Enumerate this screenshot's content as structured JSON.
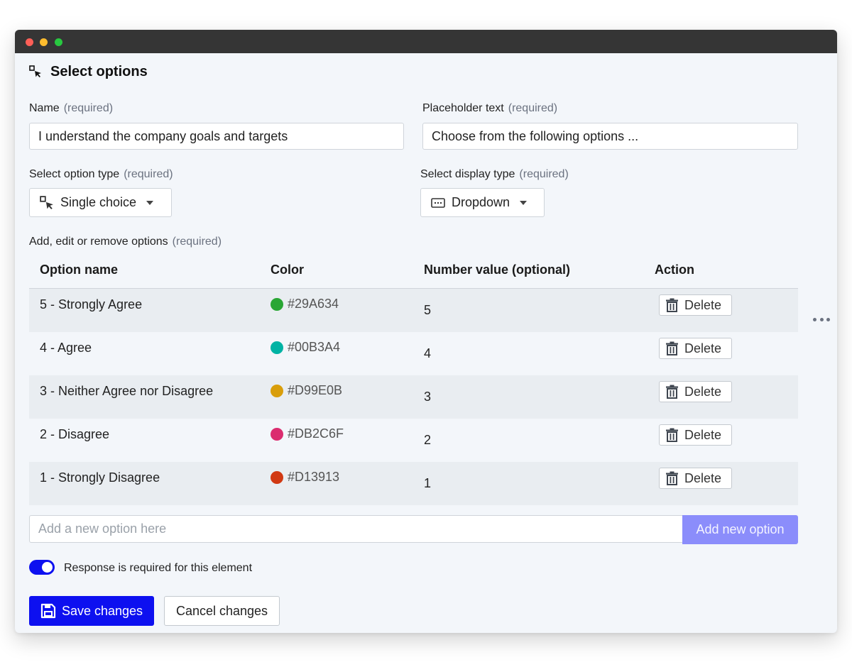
{
  "window": {
    "title_bar_buttons": [
      "close",
      "minimize",
      "maximize"
    ]
  },
  "header": {
    "title": "Select options",
    "icon": "select-cursor-icon"
  },
  "form": {
    "name": {
      "label": "Name",
      "req": "(required)",
      "value": "I understand the company goals and targets"
    },
    "placeholder": {
      "label": "Placeholder text",
      "req": "(required)",
      "value": "Choose from the following options ..."
    },
    "option_type": {
      "label": "Select option type",
      "req": "(required)",
      "value": "Single choice",
      "icon": "select-cursor-icon"
    },
    "display_type": {
      "label": "Select display type",
      "req": "(required)",
      "value": "Dropdown",
      "icon": "dropdown-icon"
    }
  },
  "options": {
    "label": "Add, edit or remove options",
    "req": "(required)",
    "columns": [
      "Option name",
      "Color",
      "Number value (optional)",
      "Action"
    ],
    "rows": [
      {
        "name": "5 - Strongly Agree",
        "color": "#29A634",
        "value": "5",
        "action": "Delete"
      },
      {
        "name": "4 - Agree",
        "color": "#00B3A4",
        "value": "4",
        "action": "Delete"
      },
      {
        "name": "3 - Neither Agree nor Disagree",
        "color": "#D99E0B",
        "value": "3",
        "action": "Delete"
      },
      {
        "name": "2 - Disagree",
        "color": "#DB2C6F",
        "value": "2",
        "action": "Delete"
      },
      {
        "name": "1 - Strongly Disagree",
        "color": "#D13913",
        "value": "1",
        "action": "Delete"
      }
    ],
    "add_placeholder": "Add a new option here",
    "add_button": "Add new option"
  },
  "required_toggle": {
    "label": "Response is required for this element",
    "on": true
  },
  "actions": {
    "save": "Save changes",
    "cancel": "Cancel changes"
  },
  "colors": {
    "accent": "#0D10F0",
    "accent_light": "#8B8DFB",
    "background": "#F3F6FA",
    "row_shade": "#E9EDF1"
  }
}
